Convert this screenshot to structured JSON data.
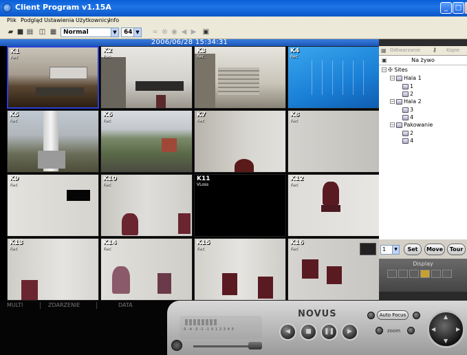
{
  "window": {
    "title": "Client Program v1.15A"
  },
  "menu": [
    "Plik",
    "Podgląd",
    "Ustawienia",
    "Użytkownicy",
    "Info"
  ],
  "toolbar": {
    "view_mode": "Normal",
    "channels": "64",
    "icons": [
      "open-folder-icon",
      "save-icon",
      "print-icon",
      "book-icon",
      "grid-icon",
      "binoculars-icon",
      "stop-circle-icon",
      "record-icon",
      "prev-icon",
      "next-icon",
      "info-icon"
    ]
  },
  "timestamp": "2006/06/28 15:34:31",
  "cameras": [
    {
      "id": "K1",
      "status": "Rec"
    },
    {
      "id": "K2",
      "status": "Rec"
    },
    {
      "id": "K3",
      "status": "Rec"
    },
    {
      "id": "K4",
      "status": "Rec"
    },
    {
      "id": "K5",
      "status": "Rec"
    },
    {
      "id": "K6",
      "status": "Rec"
    },
    {
      "id": "K7",
      "status": "Rec"
    },
    {
      "id": "K8",
      "status": "Rec"
    },
    {
      "id": "K9",
      "status": "Rec"
    },
    {
      "id": "K10",
      "status": "Rec"
    },
    {
      "id": "K11",
      "status": "VLoss"
    },
    {
      "id": "K12",
      "status": "Rec"
    },
    {
      "id": "K13",
      "status": "Rec"
    },
    {
      "id": "K14",
      "status": "Rec"
    },
    {
      "id": "K15",
      "status": "Rec"
    },
    {
      "id": "K16",
      "status": "Rec"
    }
  ],
  "side_panel": {
    "tabs": [
      "Odtwarzanie",
      "Kopie"
    ],
    "live_label": "Na żywo",
    "tree": {
      "root": "Sites",
      "groups": [
        {
          "name": "Hala 1",
          "children": [
            "1",
            "2"
          ]
        },
        {
          "name": "Hala 2",
          "children": [
            "3",
            "4"
          ]
        },
        {
          "name": "Pakowanie",
          "children": [
            "2",
            "4"
          ]
        }
      ]
    },
    "preset_value": "1",
    "buttons": {
      "set": "Set",
      "move": "Move",
      "tour": "Tour"
    },
    "display_label": "Display"
  },
  "events": {
    "columns": [
      "MULTI",
      "ZDARZENIE",
      "DATA"
    ]
  },
  "console": {
    "brand": "NOVUS",
    "scale_numbers": "-5 -4 -3 -2 -1 0 1 2 3 4 5",
    "autofocus_label": "Auto Focus",
    "zoom_label": "zoom"
  },
  "colors": {
    "titlebar": "#0a5fd8",
    "selection": "#2a3fd6",
    "active_layout": "#c8a030"
  }
}
